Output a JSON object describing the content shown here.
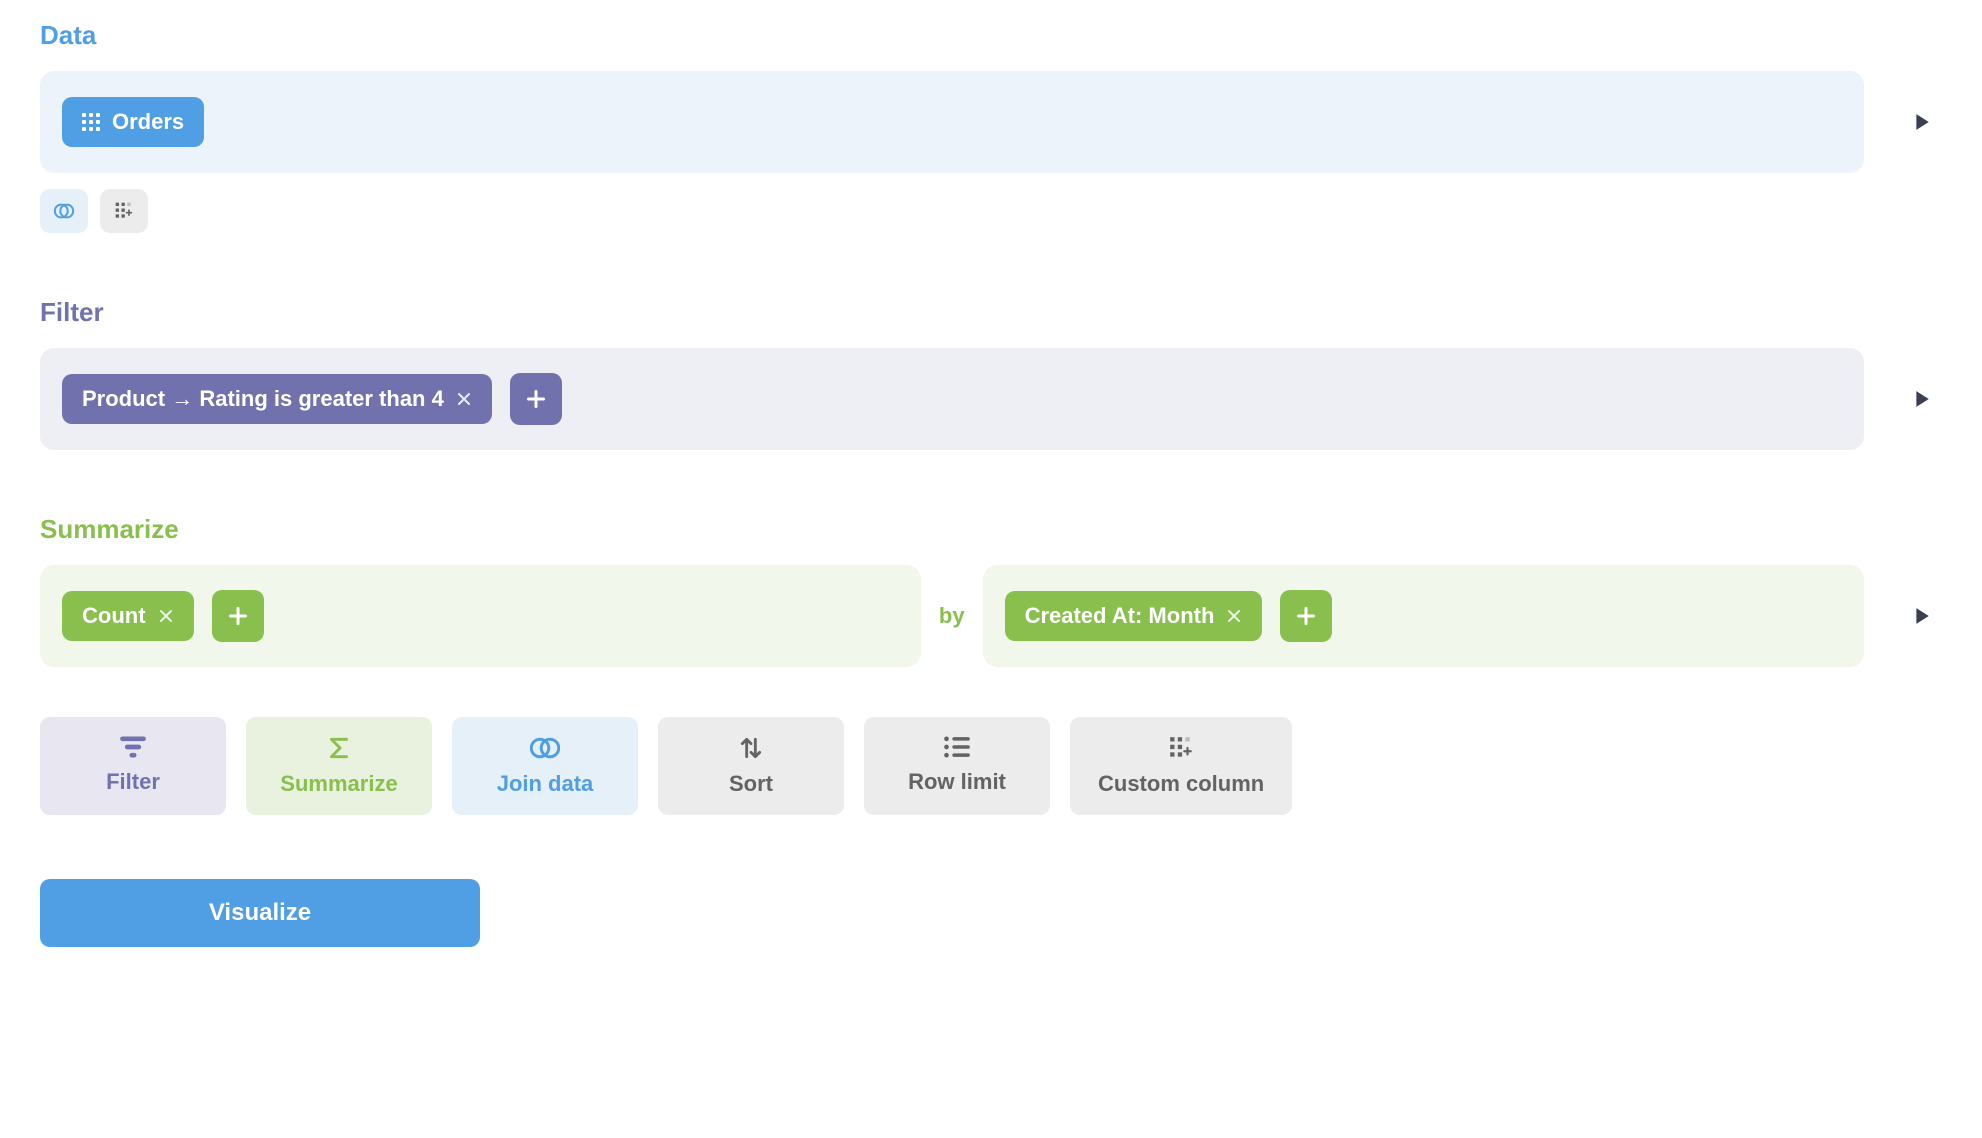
{
  "sections": {
    "data": {
      "title": "Data"
    },
    "filter": {
      "title": "Filter"
    },
    "summarize": {
      "title": "Summarize"
    }
  },
  "data_source": {
    "table": "Orders"
  },
  "filters": [
    {
      "label": "Product → Rating is greater than 4"
    }
  ],
  "summarize": {
    "aggregations": [
      {
        "label": "Count"
      }
    ],
    "by_word": "by",
    "groupings": [
      {
        "label": "Created At: Month"
      }
    ]
  },
  "actions": {
    "filter": "Filter",
    "summarize": "Summarize",
    "join": "Join data",
    "sort": "Sort",
    "row_limit": "Row limit",
    "custom_column": "Custom column"
  },
  "buttons": {
    "visualize": "Visualize"
  },
  "icons": {
    "table": "table-grid-icon",
    "join": "join-icon",
    "custom": "custom-column-icon",
    "play": "play-icon",
    "close": "close-icon",
    "plus": "plus-icon",
    "filter": "filter-icon",
    "sigma": "sigma-icon",
    "sort": "sort-icon",
    "list": "list-icon"
  }
}
